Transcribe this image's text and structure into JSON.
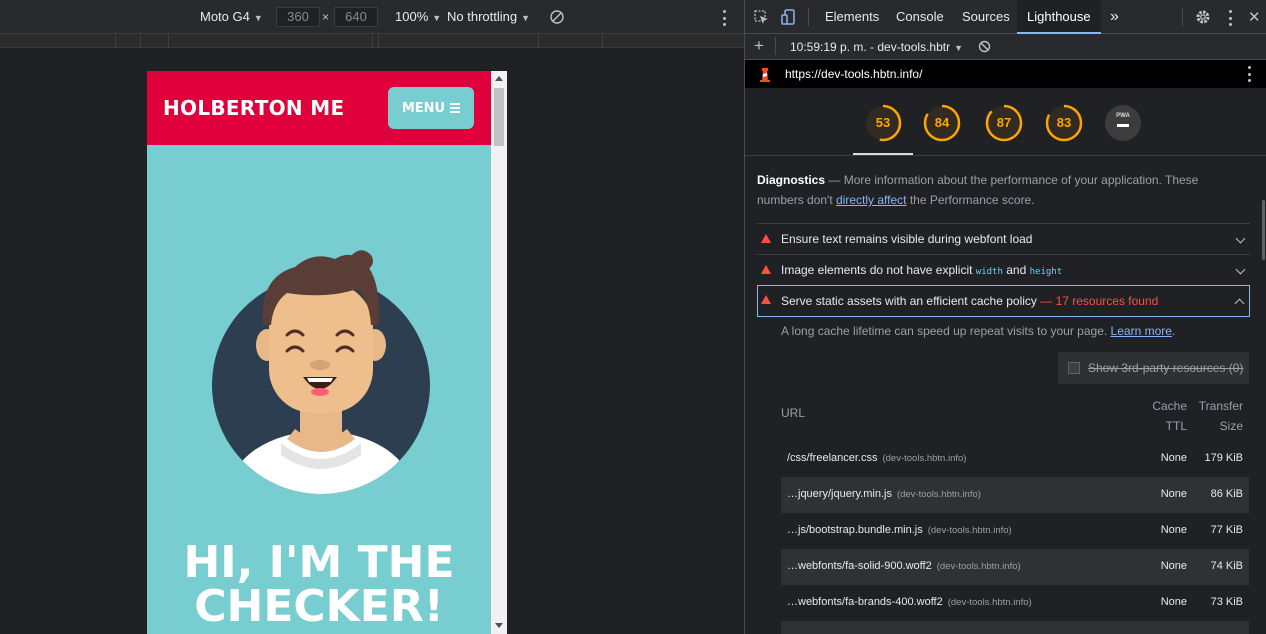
{
  "device_toolbar": {
    "device": "Moto G4",
    "width": "360",
    "times": "×",
    "height": "640",
    "zoom": "100%",
    "throttling": "No throttling"
  },
  "site": {
    "brand": "HOLBERTON ME",
    "menu_label": "MENU",
    "hero_line1": "HI, I'M THE",
    "hero_line2": "CHECKER!"
  },
  "devtools": {
    "tabs": [
      "Elements",
      "Console",
      "Sources",
      "Lighthouse"
    ],
    "more_tabs": "»",
    "active_tab": "Lighthouse",
    "report_time": "10:59:19 p. m. - dev-tools.hbtr",
    "url": "https://dev-tools.hbtn.info/",
    "scores": [
      {
        "value": 53,
        "fraction": 0.53
      },
      {
        "value": 84,
        "fraction": 0.84
      },
      {
        "value": 87,
        "fraction": 0.87
      },
      {
        "value": 83,
        "fraction": 0.83
      }
    ],
    "pwa_label": "PWA",
    "colors": {
      "average": "#ffa400",
      "fail": "#ff4e42",
      "link": "#8ab4f8",
      "code": "#67d2f8"
    },
    "diagnostics": {
      "title": "Diagnostics",
      "dash": "—",
      "text_before": "More information about the performance of your application. These numbers don't",
      "link": "directly affect",
      "text_after": "the Performance score."
    },
    "audits": [
      {
        "title": "Ensure text remains visible during webfont load"
      },
      {
        "title_pre": "Image elements do not have explicit",
        "code1": "width",
        "and": "and",
        "code2": "height"
      },
      {
        "title": "Serve static assets with an efficient cache policy",
        "found": "— 17 resources found"
      }
    ],
    "audit_description": "A long cache lifetime can speed up repeat visits to your page.",
    "learn_more": "Learn more",
    "third_party": "Show 3rd-party resources (0)",
    "table": {
      "col_url": "URL",
      "col_cache_1": "Cache",
      "col_cache_2": "TTL",
      "col_size_1": "Transfer",
      "col_size_2": "Size",
      "rows": [
        {
          "path": "/css/freelancer.css",
          "host": "(dev-tools.hbtn.info)",
          "ttl": "None",
          "size": "179 KiB"
        },
        {
          "path": "…jquery/jquery.min.js",
          "host": "(dev-tools.hbtn.info)",
          "ttl": "None",
          "size": "86 KiB"
        },
        {
          "path": "…js/bootstrap.bundle.min.js",
          "host": "(dev-tools.hbtn.info)",
          "ttl": "None",
          "size": "77 KiB"
        },
        {
          "path": "…webfonts/fa-solid-900.woff2",
          "host": "(dev-tools.hbtn.info)",
          "ttl": "None",
          "size": "74 KiB"
        },
        {
          "path": "…webfonts/fa-brands-400.woff2",
          "host": "(dev-tools.hbtn.info)",
          "ttl": "None",
          "size": "73 KiB"
        }
      ]
    }
  }
}
